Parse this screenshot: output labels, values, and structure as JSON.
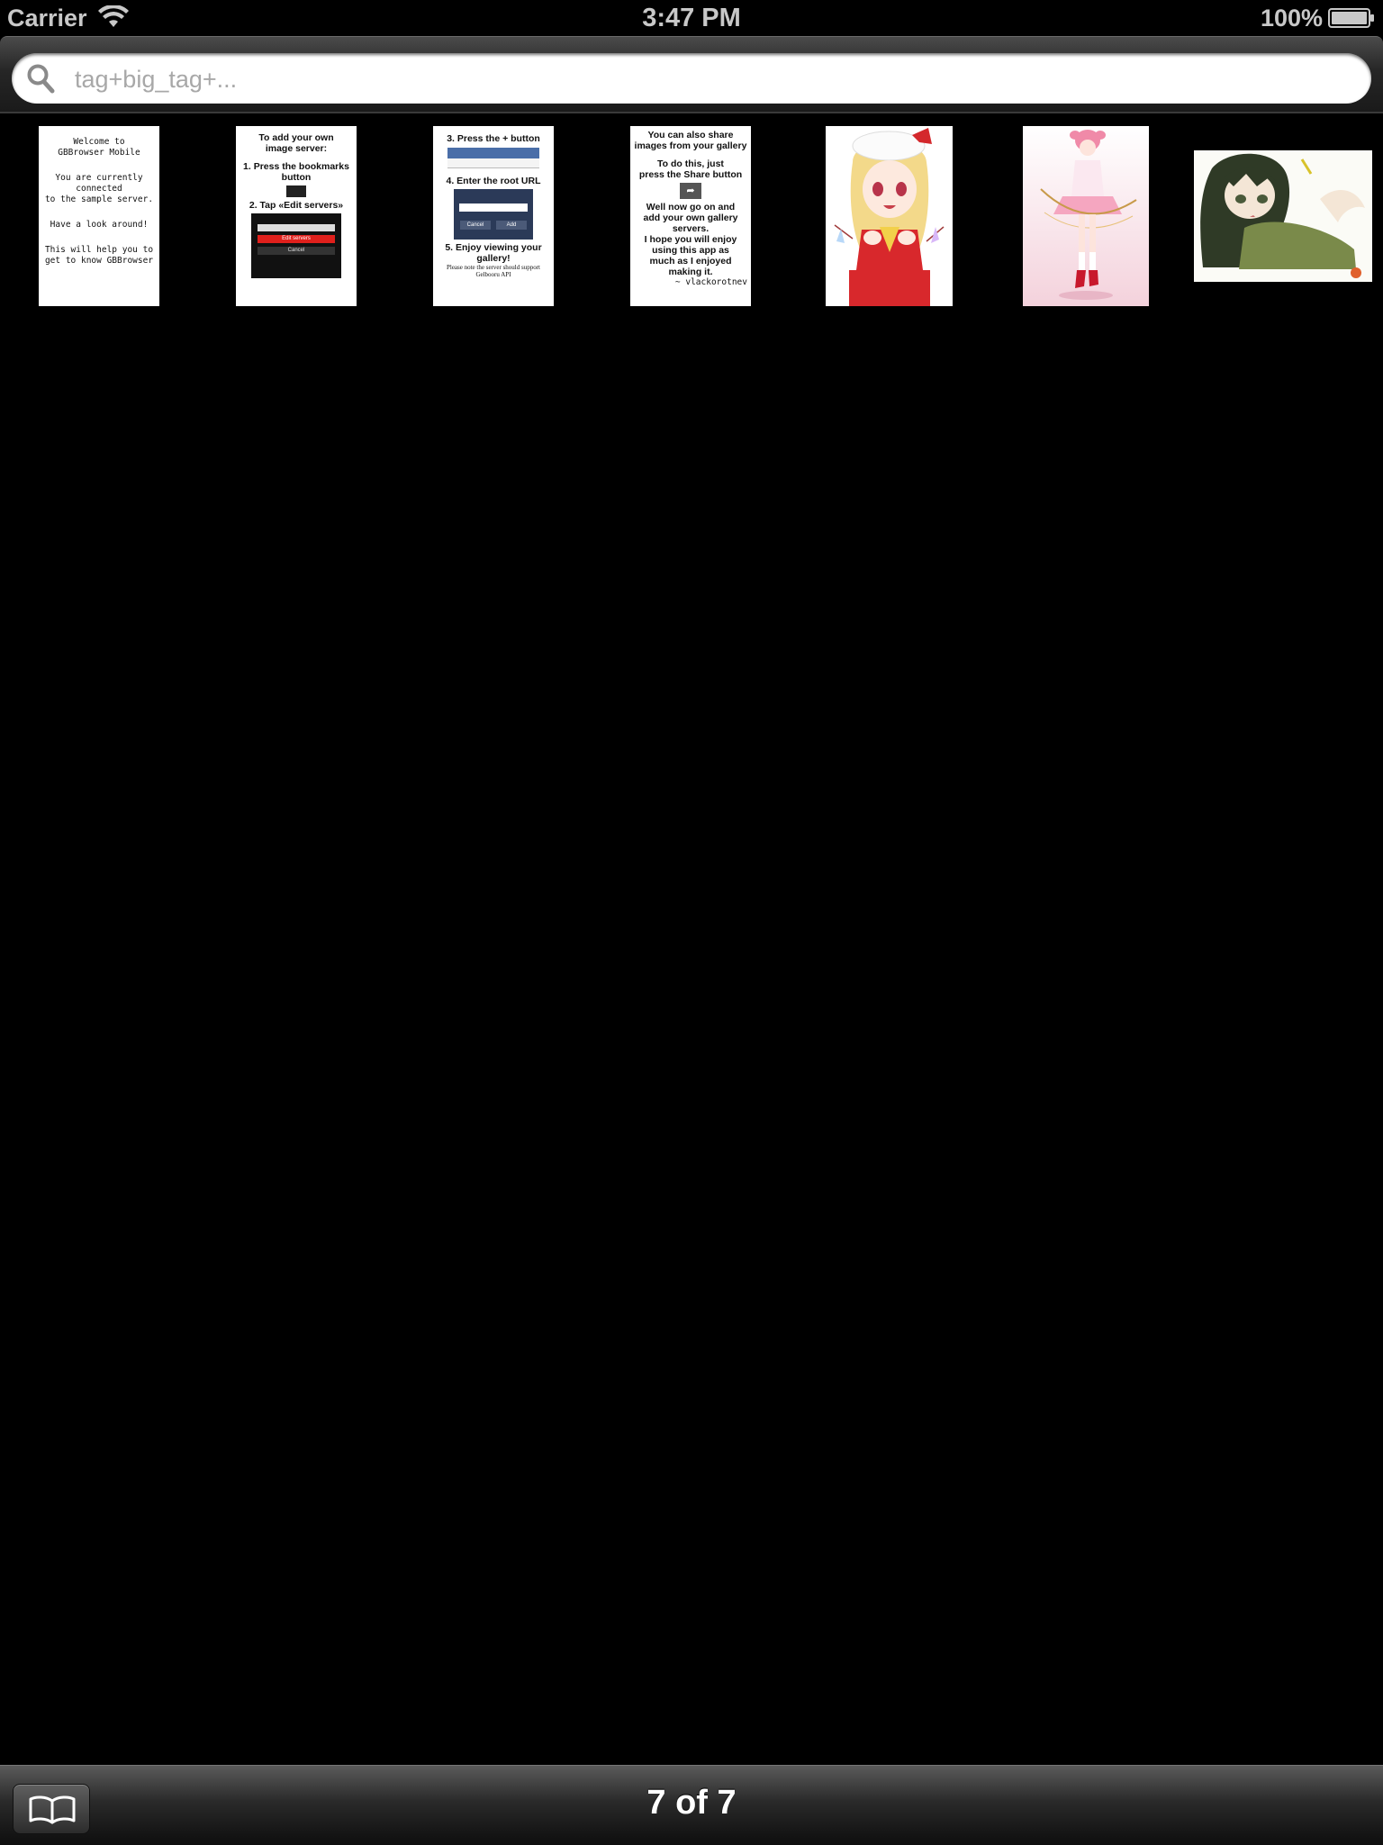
{
  "status_bar": {
    "carrier": "Carrier",
    "time": "3:47 PM",
    "battery": "100%"
  },
  "search": {
    "placeholder": "tag+big_tag+..."
  },
  "thumbnails": [
    {
      "kind": "text",
      "lines": [
        "Welcome to",
        "GBBrowser Mobile",
        "",
        "You are currently connected",
        "to the sample server.",
        "",
        "Have a look around!",
        "",
        "This will help you to",
        "get to know GBBrowser"
      ]
    },
    {
      "kind": "text",
      "lines": [
        "To add your own",
        "image server:",
        "1. Press the bookmarks",
        "button",
        "2. Tap «Edit servers»"
      ],
      "mini_buttons": [
        "Edit servers",
        "Cancel"
      ]
    },
    {
      "kind": "text",
      "lines": [
        "3. Press the + button",
        "4. Enter the root URL",
        "5. Enjoy viewing your",
        "gallery!",
        "Please note the server should support",
        "Gelbooru API"
      ],
      "mini_buttons": [
        "Cancel",
        "Add"
      ]
    },
    {
      "kind": "text",
      "lines": [
        "You can also share",
        "images from your gallery",
        "To do this, just",
        "press the Share button",
        "Well now go on and",
        "add your own gallery",
        "servers.",
        "I hope you will enjoy",
        "using this app as",
        "much as I enjoyed",
        "making it.",
        "~ vlackorotnev"
      ]
    },
    {
      "kind": "image",
      "icon": "blonde-girl-illustration"
    },
    {
      "kind": "image",
      "icon": "pink-hair-girl-illustration"
    },
    {
      "kind": "image",
      "icon": "dark-hair-girl-illustration"
    }
  ],
  "toolbar": {
    "page_counter": "7 of 7",
    "bookmarks_icon": "open-book-icon"
  }
}
